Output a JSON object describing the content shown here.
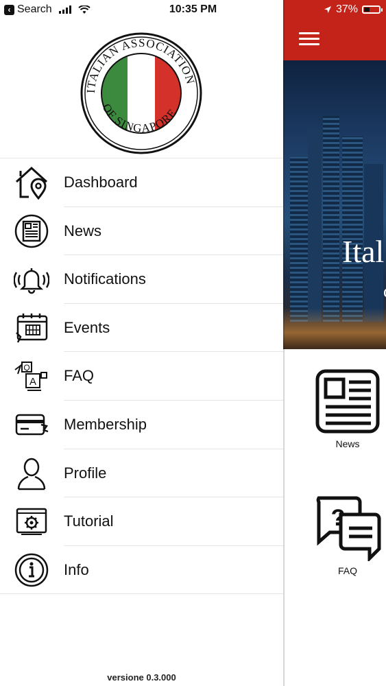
{
  "status_bar": {
    "back_label": "Search",
    "time": "10:35 PM",
    "battery": "37%",
    "battery_level": 0.37
  },
  "logo": {
    "text": "ITALIAN ASSOCIATION OF SINGAPORE",
    "colors": {
      "green": "#3c8a3e",
      "white": "#ffffff",
      "red": "#d3312a"
    }
  },
  "menu": {
    "items": [
      {
        "label": "Dashboard",
        "icon": "home-location-icon"
      },
      {
        "label": "News",
        "icon": "newspaper-icon"
      },
      {
        "label": "Notifications",
        "icon": "bell-icon"
      },
      {
        "label": "Events",
        "icon": "calendar-icon"
      },
      {
        "label": "FAQ",
        "icon": "faq-icon"
      },
      {
        "label": "Membership",
        "icon": "membership-card-icon"
      },
      {
        "label": "Profile",
        "icon": "user-icon"
      },
      {
        "label": "Tutorial",
        "icon": "tutorial-gear-icon"
      },
      {
        "label": "Info",
        "icon": "info-icon"
      }
    ]
  },
  "footer": {
    "version": "versione 0.3.000"
  },
  "main_app": {
    "header_color": "#c4231a",
    "hero_title": "Ital",
    "hero_sub": "c",
    "tiles": [
      {
        "label": "News",
        "icon": "newspaper-icon"
      },
      {
        "label": "FAQ",
        "icon": "faq-chat-icon"
      }
    ]
  }
}
